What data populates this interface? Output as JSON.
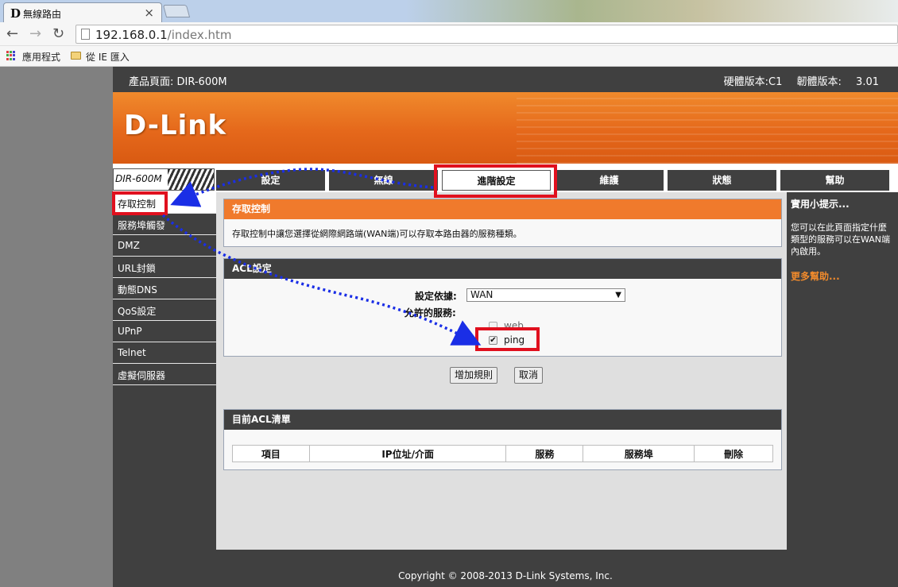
{
  "browser": {
    "tab_title": "無線路由",
    "tab_favicon": "D",
    "tab_close": "×",
    "url_host": "192.168.0.1",
    "url_path": "/index.htm",
    "bookmarks": [
      "應用程式",
      "從 IE 匯入"
    ]
  },
  "header": {
    "product": "產品頁面: DIR-600M",
    "versions": "硬體版本:C1 韌體版本: 3.01",
    "logo": "D-Link",
    "model": "DIR-600M"
  },
  "nav_tabs": [
    "設定",
    "無線",
    "進階設定",
    "維護",
    "狀態",
    "幫助"
  ],
  "active_tab": "進階設定",
  "sidebar": {
    "items": [
      "存取控制",
      "服務埠觸發",
      "DMZ",
      "URL封鎖",
      "動態DNS",
      "QoS設定",
      "UPnP",
      "Telnet",
      "虛擬伺服器"
    ],
    "active": "存取控制"
  },
  "access_control": {
    "title": "存取控制",
    "description": "存取控制中讓您選擇從網際網路端(WAN端)可以存取本路由器的服務種類。"
  },
  "acl_settings": {
    "title": "ACL設定",
    "basis_label": "設定依據:",
    "basis_value": "WAN",
    "services_label": "允許的服務:",
    "services": [
      {
        "name": "web",
        "checked": false
      },
      {
        "name": "ping",
        "checked": true
      }
    ],
    "add_button": "增加規則",
    "cancel_button": "取消"
  },
  "acl_list": {
    "title": "目前ACL清單",
    "columns": [
      "項目",
      "IP位址/介面",
      "服務",
      "服務埠",
      "刪除"
    ]
  },
  "tips": {
    "title": "實用小提示...",
    "text": "您可以在此頁面指定什麼類型的服務可以在WAN端內啟用。",
    "more": "更多幫助..."
  },
  "footer": {
    "copyright": "Copyright © 2008-2013 D-Link Systems, Inc."
  },
  "colors": {
    "accent_orange": "#f07a2c",
    "dark_gray": "#404040",
    "annotation_red": "#e0101e",
    "annotation_blue": "#1a2ee6"
  }
}
